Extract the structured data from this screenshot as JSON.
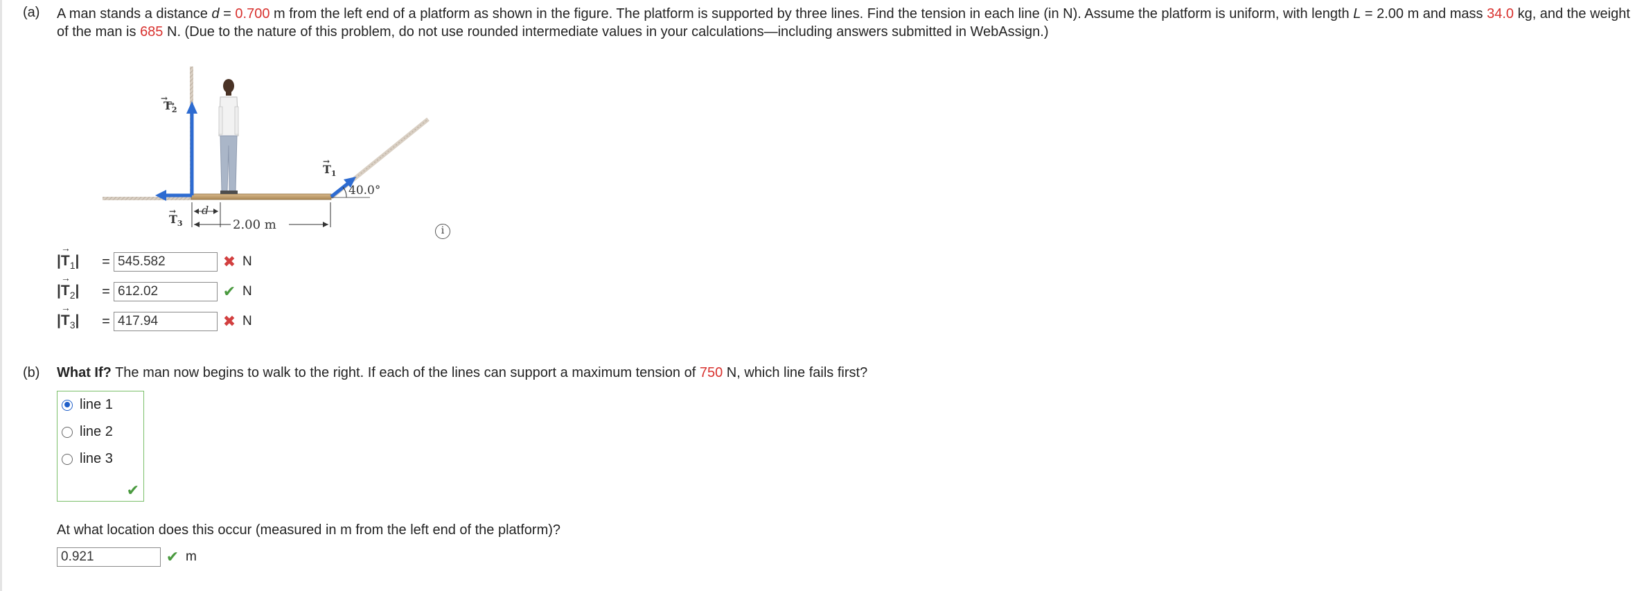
{
  "part_a": {
    "label": "(a)",
    "text_1": "A man stands a distance ",
    "d_var": "d",
    "text_2": " = ",
    "d_value": "0.700",
    "text_3": " m from the left end of a platform as shown in the figure. The platform is supported by three lines. Find the tension in each line (in N). Assume the platform is uniform, with length ",
    "L_var": "L",
    "text_4": " = 2.00 m and mass ",
    "mass_value": "34.0",
    "text_5": " kg, and the weight of the man is ",
    "weight_value": "685",
    "text_6": " N. (Due to the nature of this problem, do not use rounded intermediate values in your calculations—including answers submitted in WebAssign.)"
  },
  "figure": {
    "t1_label": "T",
    "t1_sub": "1",
    "t2_label": "T",
    "t2_sub": "2",
    "t3_label": "T",
    "t3_sub": "3",
    "angle_label": "40.0°",
    "d_label": "d",
    "length_label": "2.00 m"
  },
  "answers": [
    {
      "symbol": "T",
      "sub": "1",
      "value": "545.582",
      "status": "wrong",
      "mark": "✖",
      "unit": "N"
    },
    {
      "symbol": "T",
      "sub": "2",
      "value": "612.02",
      "status": "right",
      "mark": "✔",
      "unit": "N"
    },
    {
      "symbol": "T",
      "sub": "3",
      "value": "417.94",
      "status": "wrong",
      "mark": "✖",
      "unit": "N"
    }
  ],
  "part_b": {
    "label": "(b)",
    "bold_lead": "What If?",
    "text_1": " The man now begins to walk to the right. If each of the lines can support a maximum tension of ",
    "max_tension": "750",
    "text_2": " N, which line fails first?",
    "options": [
      {
        "label": "line 1",
        "checked": true
      },
      {
        "label": "line 2",
        "checked": false
      },
      {
        "label": "line 3",
        "checked": false
      }
    ],
    "box_mark": "✔",
    "location_question": "At what location does this occur (measured in m from the left end of the platform)?",
    "location_value": "0.921",
    "location_mark": "✔",
    "location_unit": "m"
  },
  "colors": {
    "highlight_red": "#d8312e",
    "correct_green": "#4a9a3f",
    "wrong_red": "#d23f3f",
    "vector_blue": "#2d6bd1"
  },
  "icons": {
    "info": "info-circle-icon",
    "wrong": "x-mark-icon",
    "right": "check-mark-icon"
  }
}
